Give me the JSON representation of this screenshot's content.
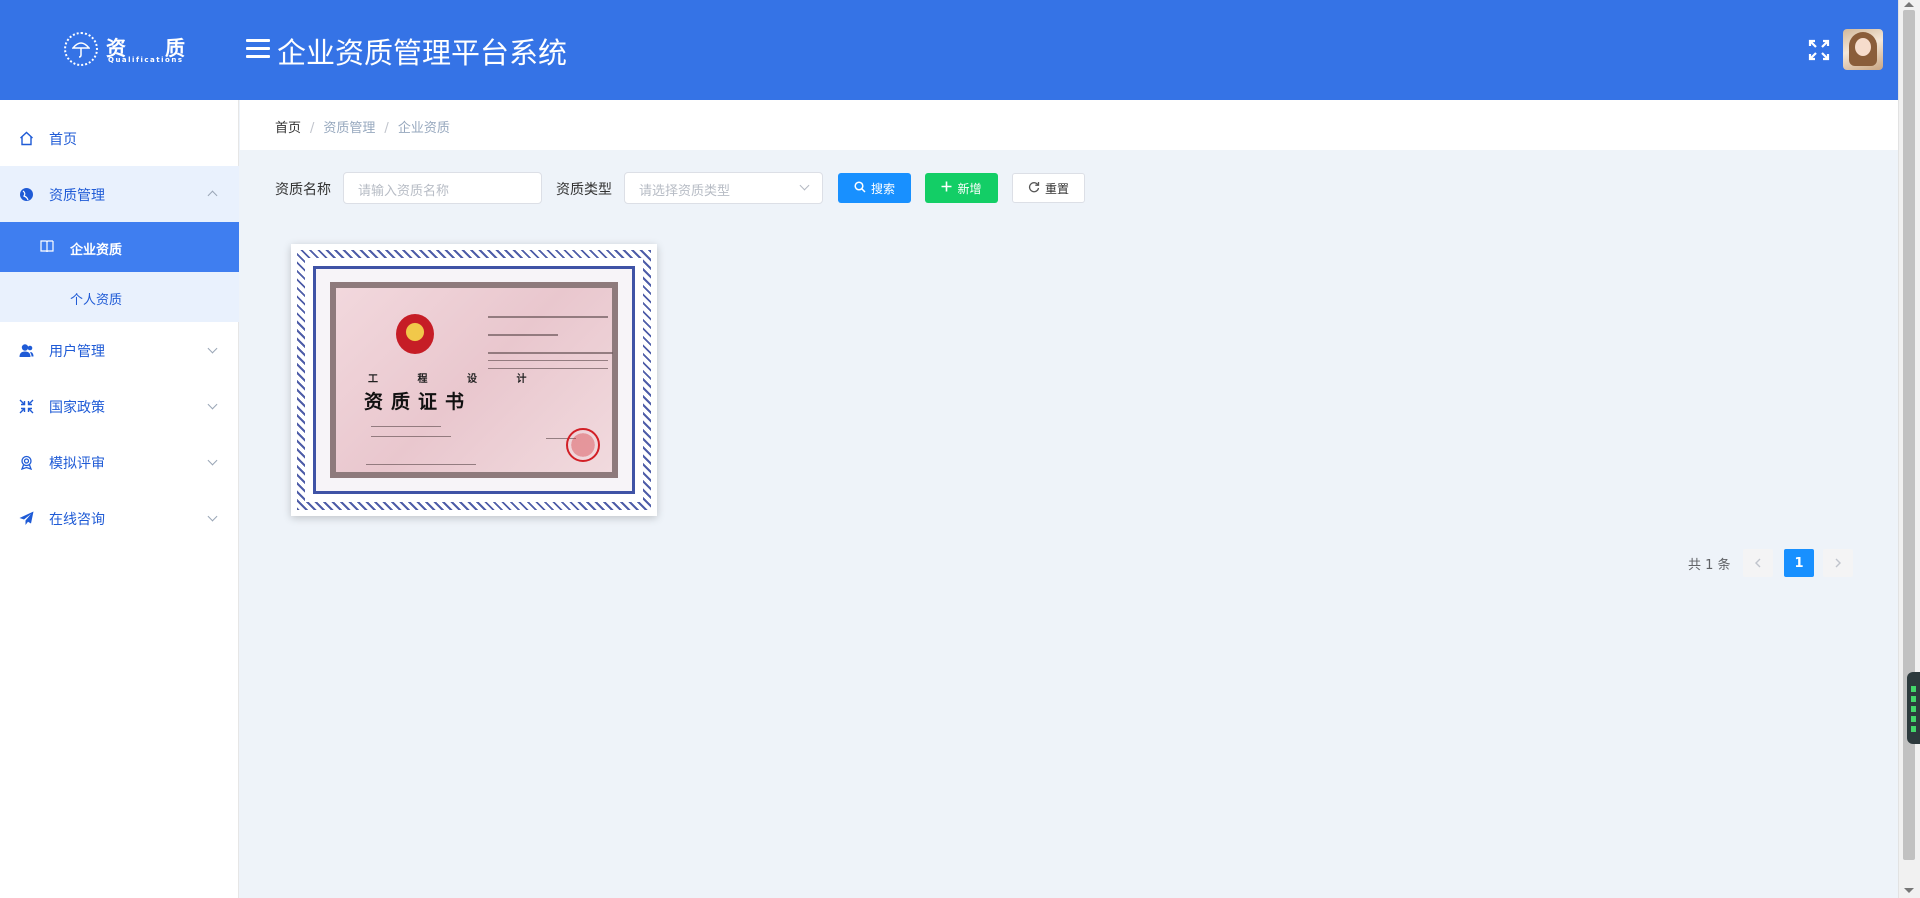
{
  "header": {
    "logo_text": "资 质",
    "logo_sub": "Qualifications",
    "app_title": "企业资质管理平台系统"
  },
  "sidebar": {
    "items": [
      {
        "label": "首页",
        "icon": "home-icon"
      },
      {
        "label": "资质管理",
        "icon": "globe-icon",
        "expanded": true,
        "children": [
          {
            "label": "企业资质",
            "icon": "book-icon",
            "active": true
          },
          {
            "label": "个人资质"
          }
        ]
      },
      {
        "label": "用户管理",
        "icon": "users-icon"
      },
      {
        "label": "国家政策",
        "icon": "compress-icon"
      },
      {
        "label": "模拟评审",
        "icon": "badge-icon"
      },
      {
        "label": "在线咨询",
        "icon": "send-icon"
      }
    ]
  },
  "breadcrumb": [
    "首页",
    "资质管理",
    "企业资质"
  ],
  "filters": {
    "name_label": "资质名称",
    "name_placeholder": "请输入资质名称",
    "type_label": "资质类型",
    "type_placeholder": "请选择资质类型"
  },
  "buttons": {
    "search": "搜索",
    "add": "新增",
    "reset": "重置"
  },
  "card": {
    "certificate_title_line1": "工 程 设 计",
    "certificate_title_line2": "资质证书"
  },
  "pagination": {
    "total": "共 1 条",
    "current_page": "1"
  },
  "colors": {
    "header_bg": "#3573e6",
    "menu_active_bg": "#3f7ef0",
    "submenu_bg": "#e9f1fd",
    "primary": "#1890ff",
    "success": "#13ce66"
  }
}
